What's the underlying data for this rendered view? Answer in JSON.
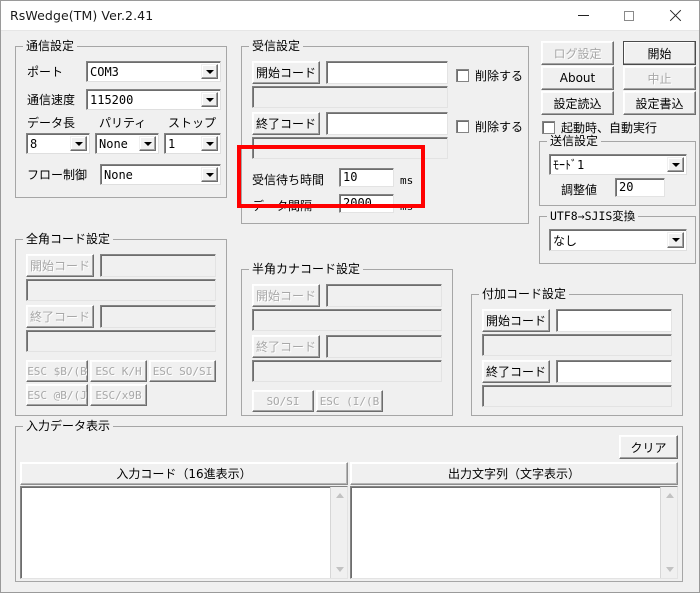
{
  "window": {
    "title": "RsWedge(TM) Ver.2.41",
    "controls": {
      "minimize": "minimize-icon",
      "maximize": "maximize-icon",
      "close": "close-icon"
    }
  },
  "comm_settings": {
    "legend": "通信設定",
    "port_label": "ポート",
    "port_value": "COM3",
    "baud_label": "通信速度",
    "baud_value": "115200",
    "databits_label": "データ長",
    "databits_value": "8",
    "parity_label": "パリティ",
    "parity_value": "None",
    "stopbits_label": "ストップ",
    "stopbits_value": "1",
    "flow_label": "フロー制御",
    "flow_value": "None"
  },
  "receive_settings": {
    "legend": "受信設定",
    "start_code_label": "開始コード",
    "start_code_value": "",
    "start_code_sub_value": "",
    "start_delete_label": "削除する",
    "end_code_label": "終了コード",
    "end_code_value": "",
    "end_code_sub_value": "",
    "end_delete_label": "削除する",
    "wait_time_label": "受信待ち時間",
    "wait_time_value": "10",
    "wait_time_unit": "ms",
    "data_interval_label": "データ間隔",
    "data_interval_value": "2000",
    "data_interval_unit": "ms"
  },
  "action_buttons": {
    "log_settings": "ログ設定",
    "start": "開始",
    "about": "About",
    "stop": "中止",
    "load_settings": "設定読込",
    "save_settings": "設定書込",
    "autostart_label": "起動時、自動実行"
  },
  "send_settings": {
    "legend": "送信設定",
    "mode_value": "ﾓｰﾄﾞ1",
    "adjust_label": "調整値",
    "adjust_value": "20"
  },
  "encoding": {
    "legend": "UTF8→SJIS変換",
    "value": "なし"
  },
  "zenkaku_settings": {
    "legend": "全角コード設定",
    "start_code_label": "開始コード",
    "start_code_value": "",
    "start_code_sub_value": "",
    "end_code_label": "終了コード",
    "end_code_value": "",
    "end_code_sub_value": "",
    "presets": [
      "ESC $B/(B",
      "ESC K/H",
      "ESC SO/SI",
      "ESC @B/(J",
      "ESC/x9B"
    ]
  },
  "hankaku_kana_settings": {
    "legend": "半角カナコード設定",
    "start_code_label": "開始コード",
    "start_code_value": "",
    "start_code_sub_value": "",
    "end_code_label": "終了コード",
    "end_code_value": "",
    "end_code_sub_value": "",
    "presets": [
      "SO/SI",
      "ESC (I/(B"
    ]
  },
  "additional_code_settings": {
    "legend": "付加コード設定",
    "start_code_label": "開始コード",
    "start_code_value": "",
    "start_code_sub_value": "",
    "end_code_label": "終了コード",
    "end_code_value": "",
    "end_code_sub_value": ""
  },
  "input_data_display": {
    "legend": "入力データ表示",
    "clear_button": "クリア",
    "left_header": "入力コード（16進表示）",
    "right_header": "出力文字列（文字表示）",
    "left_content": "",
    "right_content": ""
  },
  "annotation": {
    "color": "#ff0000",
    "target": "受信待ち時間 / データ間隔"
  }
}
